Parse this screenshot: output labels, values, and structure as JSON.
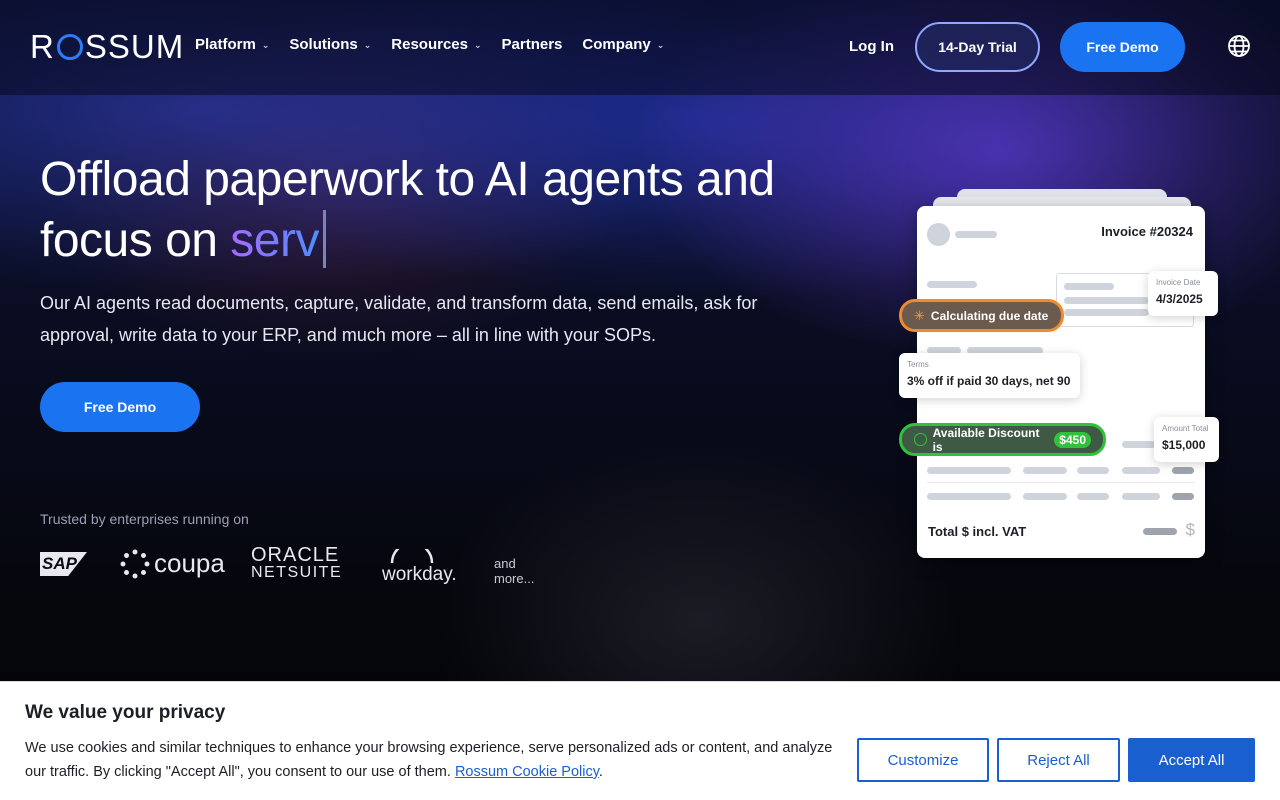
{
  "brand": {
    "logo_text_before": "R",
    "logo_text_after": "SSUM"
  },
  "nav": {
    "items": [
      {
        "label": "Platform",
        "has_dropdown": true
      },
      {
        "label": "Solutions",
        "has_dropdown": true
      },
      {
        "label": "Resources",
        "has_dropdown": true
      },
      {
        "label": "Partners",
        "has_dropdown": false
      },
      {
        "label": "Company",
        "has_dropdown": true
      }
    ],
    "login": "Log In",
    "trial": "14-Day Trial",
    "demo": "Free Demo",
    "language_icon": "globe-icon"
  },
  "hero": {
    "title_line1": "Offload paperwork to AI agents and",
    "title_line2_prefix": "focus on ",
    "title_accent": "serv",
    "subtitle": "Our AI agents read documents, capture, validate, and transform data, send emails, ask for approval, write data to your ERP, and much more – all in line with your SOPs.",
    "cta": "Free Demo",
    "trusted_label": "Trusted by enterprises running on",
    "partner_logos": {
      "sap": "SAP",
      "coupa": "coupa",
      "oracle_line1": "ORACLE",
      "oracle_line2": "NETSUITE",
      "workday": "workday."
    },
    "and_more": "and more..."
  },
  "invoice": {
    "title": "Invoice #20324",
    "invoice_date_label": "Invoice Date",
    "invoice_date": "4/3/2025",
    "status_pill": "Calculating due date",
    "terms_label": "Terms",
    "terms_value": "3% off if paid 30 days, net 90",
    "discount_label": "Available Discount is",
    "discount_amount": "$450",
    "amount_total_label": "Amount Total",
    "amount_total": "$15,000",
    "total_label": "Total $ incl. VAT",
    "colors": {
      "orange": "#f08a2a",
      "green": "#2fc23a"
    }
  },
  "cookie": {
    "title": "We value your privacy",
    "text": "We use cookies and similar techniques to enhance your browsing experience, serve personalized ads or content, and analyze our traffic. By clicking \"Accept All\", you consent to our use of them.",
    "link": "Rossum Cookie Policy",
    "customize": "Customize",
    "reject": "Reject All",
    "accept": "Accept All"
  },
  "colors": {
    "primary": "#1a73f0",
    "accent_gradient_start": "#a66bff",
    "accent_gradient_end": "#4f8dff"
  }
}
